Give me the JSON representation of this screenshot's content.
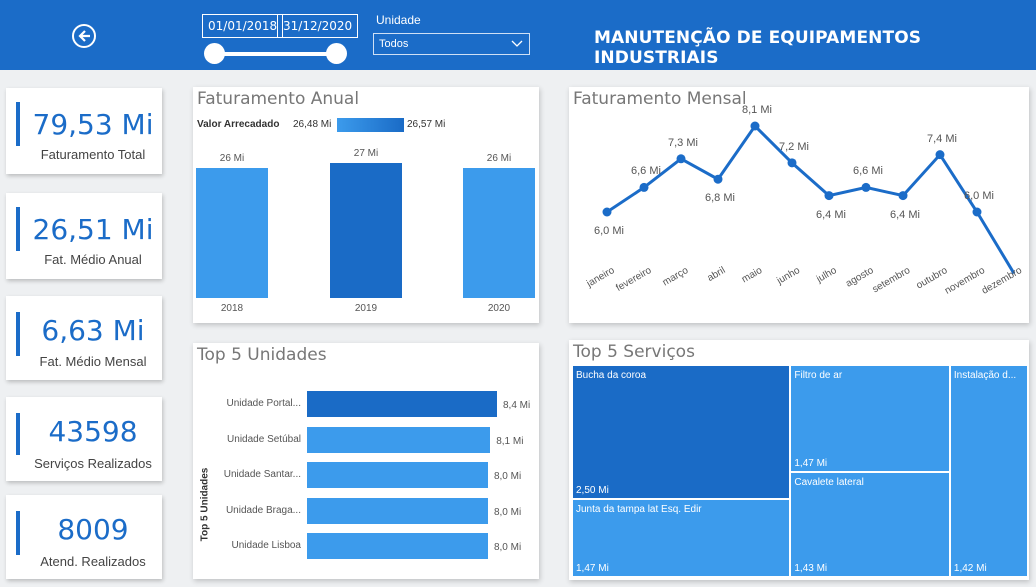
{
  "header": {
    "title": "MANUTENÇÃO DE EQUIPAMENTOS INDUSTRIAIS",
    "date_start": "01/01/2018",
    "date_end": "31/12/2020",
    "unit_label": "Unidade",
    "unit_value": "Todos"
  },
  "kpis": [
    {
      "value": "79,53 Mi",
      "label": "Faturamento Total"
    },
    {
      "value": "26,51 Mi",
      "label": "Fat. Médio Anual"
    },
    {
      "value": "6,63 Mi",
      "label": "Fat. Médio Mensal"
    },
    {
      "value": "43598",
      "label": "Serviços Realizados"
    },
    {
      "value": "8009",
      "label": "Atend. Realizados"
    }
  ],
  "annual": {
    "title": "Faturamento Anual",
    "legend_title": "Valor Arrecadado",
    "legend_min": "26,48 Mi",
    "legend_max": "26,57 Mi"
  },
  "monthly": {
    "title": "Faturamento Mensal"
  },
  "units": {
    "title": "Top 5 Unidades",
    "axis_label": "Top 5 Unidades"
  },
  "services": {
    "title": "Top 5 Serviços"
  },
  "chart_data": [
    {
      "type": "bar",
      "title": "Faturamento Anual",
      "categories": [
        "2018",
        "2019",
        "2020"
      ],
      "values": [
        26,
        27,
        26
      ],
      "data_labels": [
        "26 Mi",
        "27 Mi",
        "26 Mi"
      ],
      "colors": [
        "#3c9bec",
        "#1a6bc6",
        "#3c9bec"
      ]
    },
    {
      "type": "line",
      "title": "Faturamento Mensal",
      "categories": [
        "janeiro",
        "fevereiro",
        "março",
        "abril",
        "maio",
        "junho",
        "julho",
        "agosto",
        "setembro",
        "outubro",
        "novembro",
        "dezembro"
      ],
      "values": [
        6.0,
        6.6,
        7.3,
        6.8,
        8.1,
        7.2,
        6.4,
        6.6,
        6.4,
        7.4,
        6.0,
        4.5
      ],
      "data_labels": [
        "6,0 Mi",
        "6,6 Mi",
        "7,3 Mi",
        "6,8 Mi",
        "8,1 Mi",
        "7,2 Mi",
        "6,4 Mi",
        "6,6 Mi",
        "6,4 Mi",
        "7,4 Mi",
        "6,0 Mi",
        ""
      ],
      "color": "#1b6cc8"
    },
    {
      "type": "bar",
      "orientation": "horizontal",
      "title": "Top 5 Unidades",
      "categories": [
        "Unidade Portal...",
        "Unidade Setúbal",
        "Unidade Santar...",
        "Unidade Braga...",
        "Unidade Lisboa"
      ],
      "values": [
        8.4,
        8.1,
        8.0,
        8.0,
        8.0
      ],
      "data_labels": [
        "8,4 Mi",
        "8,1 Mi",
        "8,0 Mi",
        "8,0 Mi",
        "8,0 Mi"
      ],
      "colors": [
        "#1a6bc6",
        "#3c9bec",
        "#3c9bec",
        "#3c9bec",
        "#3c9bec"
      ]
    },
    {
      "type": "treemap",
      "title": "Top 5 Serviços",
      "items": [
        {
          "name": "Bucha da coroa",
          "value": 2.5,
          "label": "2,50 Mi",
          "color": "#1a6bc6"
        },
        {
          "name": "Junta da tampa lat Esq. Edir",
          "value": 1.47,
          "label": "1,47 Mi",
          "color": "#3c9bec"
        },
        {
          "name": "Filtro de ar",
          "value": 1.47,
          "label": "1,47 Mi",
          "color": "#3c9bec"
        },
        {
          "name": "Cavalete lateral",
          "value": 1.43,
          "label": "1,43 Mi",
          "color": "#3c9bec"
        },
        {
          "name": "Instalação d...",
          "value": 1.42,
          "label": "1,42 Mi",
          "color": "#3c9bec"
        }
      ]
    }
  ]
}
